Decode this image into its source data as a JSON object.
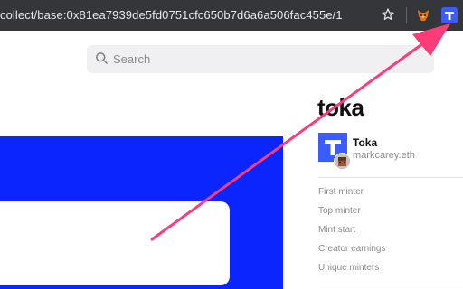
{
  "browser": {
    "url": "collect/base:0x81ea7939de5fd0751cfc650b7d6a6a506fac455e/1",
    "extension_icons": [
      "fox-icon",
      "t-logo-icon"
    ]
  },
  "search": {
    "placeholder": "Search"
  },
  "collection": {
    "title": "toka",
    "name": "Toka",
    "owner": "markcarey.eth"
  },
  "stats": [
    {
      "label": "First minter"
    },
    {
      "label": "Top minter"
    },
    {
      "label": "Mint start"
    },
    {
      "label": "Creator earnings"
    },
    {
      "label": "Unique minters"
    }
  ],
  "colors": {
    "artwork_blue": "#0b25ff",
    "brand_blue": "#3b5cff",
    "annotation_arrow": "#ff3b7a"
  }
}
